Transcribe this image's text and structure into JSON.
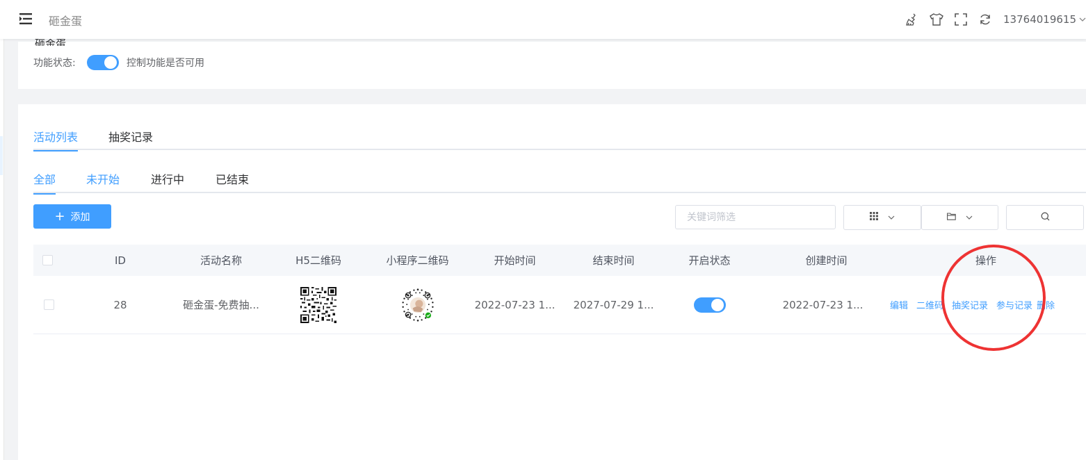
{
  "header": {
    "title": "砸金蛋",
    "username": "13764019615",
    "icons": [
      "broom-icon",
      "shirt-icon",
      "fullscreen-icon",
      "refresh-icon"
    ]
  },
  "settings": {
    "card_title": "砸金蛋",
    "func_label": "功能状态:",
    "func_enabled": true,
    "func_desc": "控制功能是否可用"
  },
  "tabs": [
    {
      "label": "活动列表",
      "active": true
    },
    {
      "label": "抽奖记录",
      "active": false
    }
  ],
  "subtabs": [
    {
      "label": "全部",
      "active": true
    },
    {
      "label": "未开始",
      "active": false
    },
    {
      "label": "进行中",
      "active": false
    },
    {
      "label": "已结束",
      "active": false
    }
  ],
  "toolbar": {
    "add_label": "添加",
    "search_placeholder": "关键词筛选"
  },
  "table": {
    "columns": [
      "ID",
      "活动名称",
      "H5二维码",
      "小程序二维码",
      "开始时间",
      "结束时间",
      "开启状态",
      "创建时间",
      "操作"
    ],
    "rows": [
      {
        "id": "28",
        "name": "砸金蛋-免费抽...",
        "start": "2022-07-23 1...",
        "end": "2027-07-29 1...",
        "enabled": true,
        "created": "2022-07-23 1...",
        "actions": [
          "编辑",
          "二维码",
          "抽奖记录",
          "参与记录",
          "删除"
        ]
      }
    ]
  },
  "colors": {
    "primary": "#409eff",
    "annotation_circle": "#ee3333"
  }
}
